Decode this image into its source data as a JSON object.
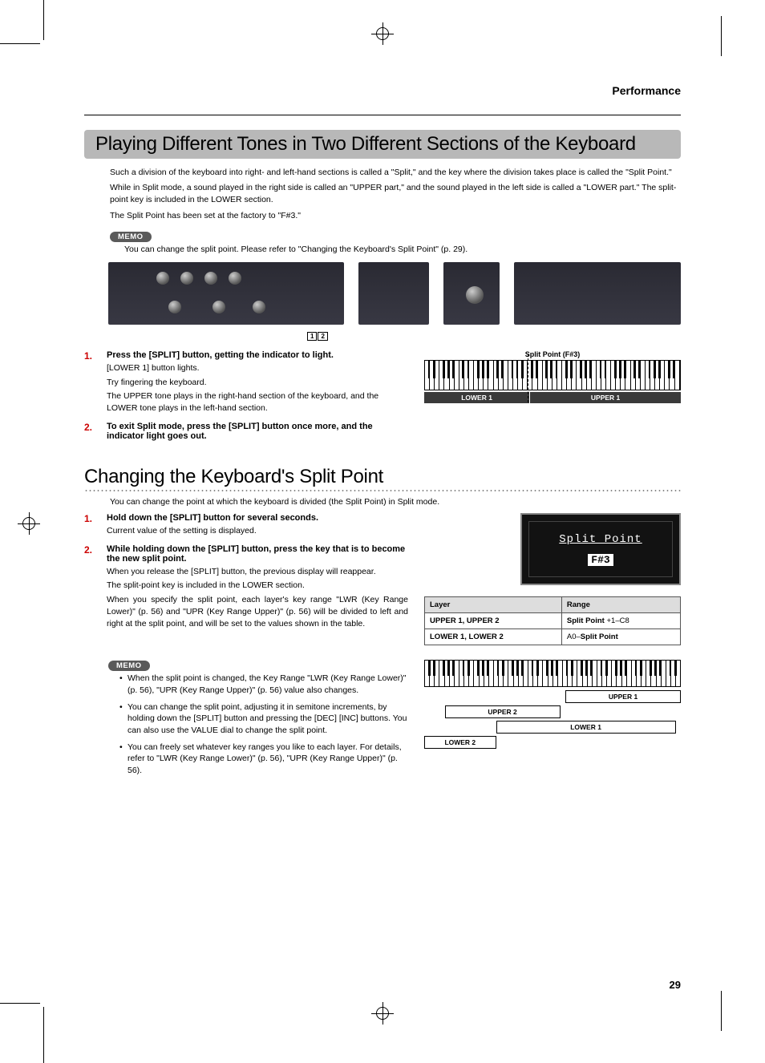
{
  "page": {
    "section": "Performance",
    "number": "29"
  },
  "section1": {
    "title": "Playing Different Tones in Two Different Sections of the Keyboard",
    "para1": "Such a division of the keyboard into right- and left-hand sections is called a \"Split,\" and the key where the division takes place is called the \"Split Point.\"",
    "para2": "While in Split mode, a sound played in the right side is called an \"UPPER part,\" and the sound played in the left side is called a \"LOWER part.\" The split-point key is included in the LOWER section.",
    "para3": "The Split Point has been set at the factory to \"F#3.\"",
    "memo_label": "MEMO",
    "memo_text": "You can change the split point. Please refer to \"Changing the Keyboard's Split Point\" (p. 29).",
    "callout1": "1",
    "callout2": "2",
    "step1_num": "1.",
    "step1_title": "Press the [SPLIT] button, getting the indicator to light.",
    "step1_a": "[LOWER 1] button lights.",
    "step1_b": "Try fingering the keyboard.",
    "step1_c": "The UPPER tone plays in the right-hand section of the keyboard, and the LOWER tone plays in the left-hand section.",
    "step2_num": "2.",
    "step2_title": "To exit Split mode, press the [SPLIT] button once more, and the indicator light goes out.",
    "kbd_split_label": "Split Point (F#3)",
    "kbd_lower": "LOWER 1",
    "kbd_upper": "UPPER 1"
  },
  "section2": {
    "title": "Changing the Keyboard's Split Point",
    "intro": "You can change the point at which the keyboard is divided (the Split Point) in Split mode.",
    "step1_num": "1.",
    "step1_title": "Hold down the [SPLIT] button for several seconds.",
    "step1_a": "Current value of the setting is displayed.",
    "step2_num": "2.",
    "step2_title": "While holding down the [SPLIT] button, press the key that is to become the new split point.",
    "step2_a": "When you release the [SPLIT] button, the previous display will reappear.",
    "step2_b": "The split-point key is included in the LOWER section.",
    "step2_c": "When you specify the split point, each layer's key range \"LWR (Key Range Lower)\" (p. 56) and \"UPR (Key Range Upper)\" (p. 56) will be divided to left and right at the split point, and will be set to the values shown in the table.",
    "lcd_line1": "Split Point",
    "lcd_line2": "F#3",
    "table": {
      "h1": "Layer",
      "h2": "Range",
      "r1c1": "UPPER 1, UPPER 2",
      "r1c2a": "Split Point",
      "r1c2b": " +1–C8",
      "r2c1": "LOWER 1, LOWER 2",
      "r2c2a": "A0–",
      "r2c2b": "Split Point"
    },
    "memo_label": "MEMO",
    "memo1": "When the split point is changed, the Key Range \"LWR (Key Range Lower)\" (p. 56),  \"UPR (Key Range Upper)\" (p. 56) value also changes.",
    "memo2": "You can change the split point, adjusting it in semitone increments, by holding down the [SPLIT] button and pressing the [DEC] [INC] buttons. You can also use the VALUE dial to change the split point.",
    "memo3": "You can freely set whatever key ranges you like to each layer. For details, refer to \"LWR (Key Range Lower)\" (p. 56),  \"UPR (Key Range Upper)\" (p. 56).",
    "layer_upper1": "UPPER 1",
    "layer_upper2": "UPPER 2",
    "layer_lower1": "LOWER 1",
    "layer_lower2": "LOWER 2"
  }
}
